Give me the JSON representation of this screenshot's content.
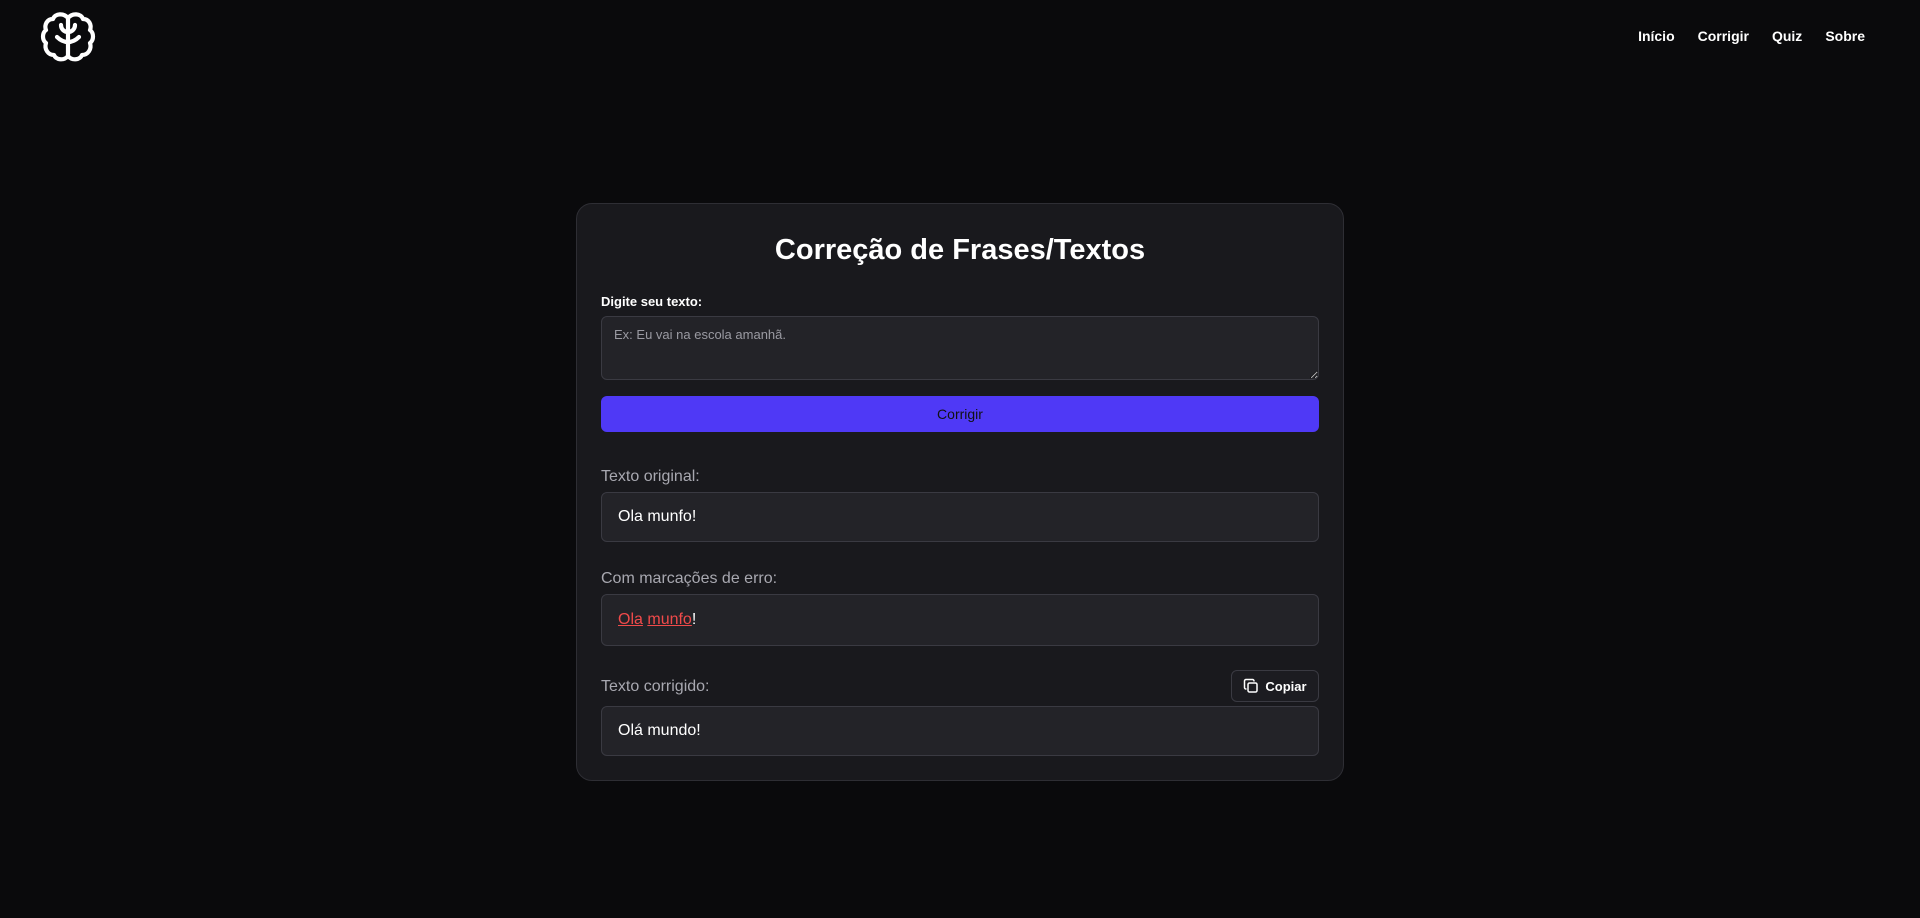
{
  "header": {
    "logo_icon": "brain-icon",
    "nav": [
      {
        "label": "Início"
      },
      {
        "label": "Corrigir"
      },
      {
        "label": "Quiz"
      },
      {
        "label": "Sobre"
      }
    ]
  },
  "card": {
    "title": "Correção de Frases/Textos",
    "input_label": "Digite seu texto:",
    "input_placeholder": "Ex: Eu vai na escola amanhã.",
    "input_value": "",
    "correct_button": "Corrigir",
    "original": {
      "label": "Texto original:",
      "text": "Ola munfo!"
    },
    "marked": {
      "label": "Com marcações de erro:",
      "error1": "Ola",
      "space": " ",
      "error2": "munfo",
      "trailing": "!"
    },
    "corrected": {
      "label": "Texto corrigido:",
      "copy_button": "Copiar",
      "copy_icon": "copy-icon",
      "text": "Olá mundo!"
    }
  },
  "colors": {
    "background": "#0a0a0c",
    "card": "#19191d",
    "accent": "#4f39f6",
    "error": "#f04a4a"
  }
}
